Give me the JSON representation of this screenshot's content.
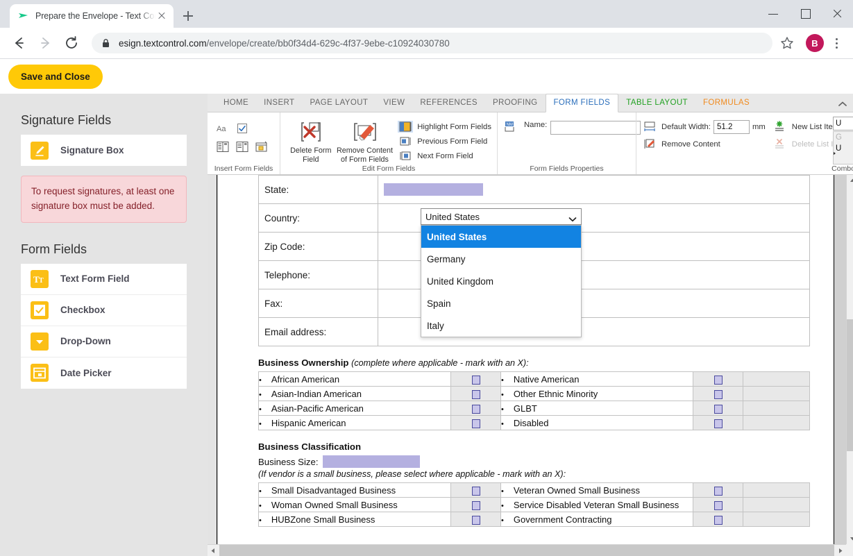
{
  "browser": {
    "tab_title": "Prepare the Envelope - Text Cont",
    "favicon": "paper-plane-icon",
    "url_host": "esign.textcontrol.com",
    "url_path": "/envelope/create/bb0f34d4-629c-4f37-9ebe-c10924030780",
    "profile_initial": "B"
  },
  "app": {
    "save_label": "Save and Close"
  },
  "sidebar": {
    "signature_heading": "Signature Fields",
    "signature_items": [
      {
        "label": "Signature Box",
        "icon": "pen-signature-icon"
      }
    ],
    "alert_text": "To request signatures, at least one signature box must be added.",
    "formfields_heading": "Form Fields",
    "formfield_items": [
      {
        "label": "Text Form Field",
        "icon": "text-field-icon"
      },
      {
        "label": "Checkbox",
        "icon": "checkbox-icon"
      },
      {
        "label": "Drop-Down",
        "icon": "dropdown-icon"
      },
      {
        "label": "Date Picker",
        "icon": "calendar-icon"
      }
    ]
  },
  "ribbon": {
    "tabs": [
      {
        "label": "HOME",
        "state": "normal"
      },
      {
        "label": "INSERT",
        "state": "normal"
      },
      {
        "label": "PAGE LAYOUT",
        "state": "normal"
      },
      {
        "label": "VIEW",
        "state": "normal"
      },
      {
        "label": "REFERENCES",
        "state": "normal"
      },
      {
        "label": "PROOFING",
        "state": "normal"
      },
      {
        "label": "FORM FIELDS",
        "state": "active"
      },
      {
        "label": "TABLE LAYOUT",
        "state": "green"
      },
      {
        "label": "FORMULAS",
        "state": "orange"
      }
    ],
    "groups": {
      "insert": {
        "label": "Insert Form Fields"
      },
      "edit": {
        "label": "Edit Form Fields",
        "delete_label": "Delete Form Field",
        "remove_label": "Remove Content of Form Fields",
        "highlight_label": "Highlight Form Fields",
        "previous_label": "Previous Form Field",
        "next_label": "Next Form Field"
      },
      "properties": {
        "label": "Form Fields Properties",
        "name_label": "Name:",
        "name_value": ""
      },
      "combo": {
        "label": "Combo",
        "default_width_label": "Default Width:",
        "default_width_value": "51.2",
        "unit": "mm",
        "remove_content_label": "Remove Content",
        "new_list_item_label": "New List Item",
        "delete_list_item_label": "Delete List Item",
        "peek_field_value": "U",
        "peek_items": [
          "G",
          "U"
        ]
      }
    }
  },
  "document": {
    "contact_rows": [
      {
        "label": "State:",
        "type": "field"
      },
      {
        "label": "Country:",
        "type": "dropdown"
      },
      {
        "label": "Zip Code:",
        "type": "empty"
      },
      {
        "label": "Telephone:",
        "type": "empty"
      },
      {
        "label": "Fax:",
        "type": "empty"
      },
      {
        "label": "Email address:",
        "type": "empty"
      }
    ],
    "dropdown": {
      "selected": "United States",
      "options": [
        "United States",
        "Germany",
        "United Kingdom",
        "Spain",
        "Italy"
      ]
    },
    "ownership": {
      "title": "Business Ownership",
      "note": "(complete where applicable - mark with an X):",
      "rows": [
        {
          "left": "African American",
          "right": "Native American"
        },
        {
          "left": "Asian-Indian American",
          "right": "Other Ethnic Minority"
        },
        {
          "left": "Asian-Pacific American",
          "right": "GLBT"
        },
        {
          "left": "Hispanic American",
          "right": "Disabled"
        }
      ]
    },
    "classification": {
      "title": "Business Classification",
      "size_label": "Business Size:",
      "note": "(If vendor is a small business, please select where applicable - mark with an X):",
      "rows": [
        {
          "left": "Small Disadvantaged Business",
          "right": "Veteran Owned Small Business"
        },
        {
          "left": "Woman Owned Small Business",
          "right": "Service Disabled Veteran Small Business"
        },
        {
          "left": "HUBZone Small Business",
          "right": "Government Contracting"
        }
      ]
    }
  },
  "colors": {
    "accent_yellow": "#ffc907",
    "alert_bg": "#f8d7da",
    "field_purple": "#b4b0e0",
    "select_blue": "#1283e2"
  }
}
